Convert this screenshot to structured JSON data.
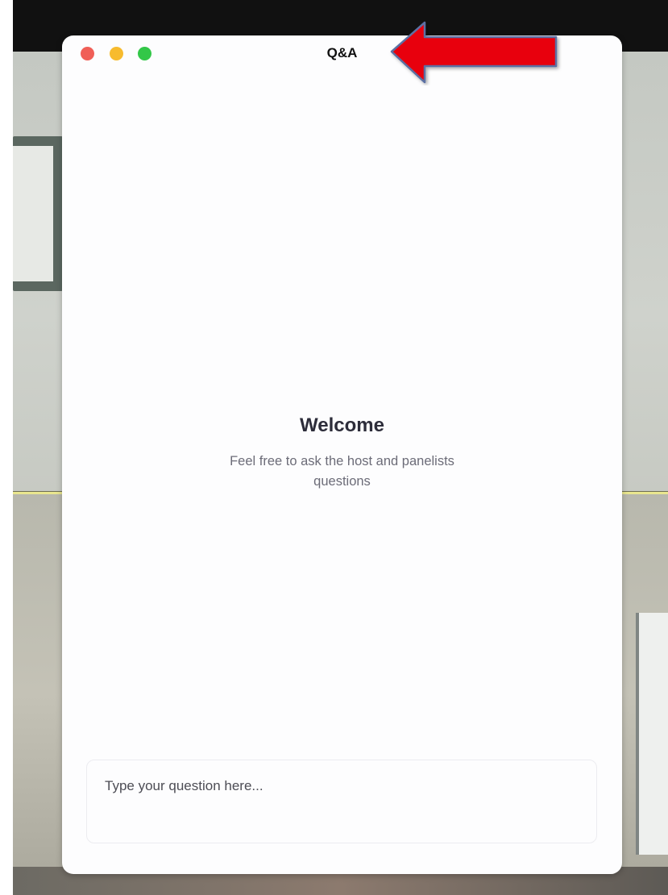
{
  "window": {
    "title": "Q&A",
    "controls": [
      "close",
      "minimize",
      "maximize"
    ]
  },
  "welcome": {
    "title": "Welcome",
    "message": "Feel free to ask the host and panelists questions"
  },
  "question_input": {
    "placeholder": "Type your question here...",
    "value": ""
  },
  "annotation": {
    "type": "arrow",
    "direction": "left",
    "color": "#e8050a",
    "outline_color": "#5b6fa3"
  },
  "colors": {
    "close": "#f05f57",
    "minimize": "#f7bb2e",
    "maximize": "#33c748"
  }
}
